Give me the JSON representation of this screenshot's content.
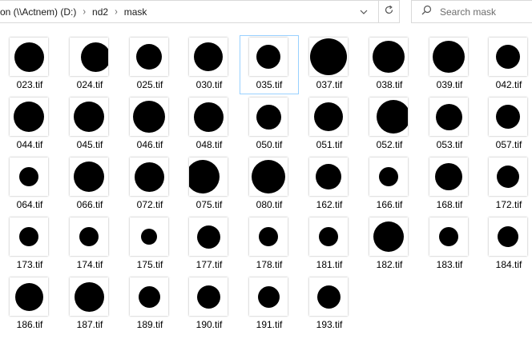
{
  "address_bar": {
    "crumbs": [
      "on (\\\\Actnem) (D:)",
      "nd2",
      "mask"
    ]
  },
  "search": {
    "placeholder": "Search mask"
  },
  "files": [
    {
      "name": "023.tif",
      "dot": 0.78
    },
    {
      "name": "024.tif",
      "dot": 0.78
    },
    {
      "name": "025.tif",
      "dot": 0.66
    },
    {
      "name": "030.tif",
      "dot": 0.76
    },
    {
      "name": "035.tif",
      "dot": 0.62
    },
    {
      "name": "037.tif",
      "dot": 0.96
    },
    {
      "name": "038.tif",
      "dot": 0.84
    },
    {
      "name": "039.tif",
      "dot": 0.84
    },
    {
      "name": "042.tif",
      "dot": 0.62
    },
    {
      "name": "044.tif",
      "dot": 0.8
    },
    {
      "name": "045.tif",
      "dot": 0.8
    },
    {
      "name": "046.tif",
      "dot": 0.84
    },
    {
      "name": "048.tif",
      "dot": 0.78
    },
    {
      "name": "050.tif",
      "dot": 0.64
    },
    {
      "name": "051.tif",
      "dot": 0.74
    },
    {
      "name": "052.tif",
      "dot": 0.88
    },
    {
      "name": "053.tif",
      "dot": 0.68
    },
    {
      "name": "057.tif",
      "dot": 0.62
    },
    {
      "name": "064.tif",
      "dot": 0.5
    },
    {
      "name": "066.tif",
      "dot": 0.8
    },
    {
      "name": "072.tif",
      "dot": 0.78
    },
    {
      "name": "075.tif",
      "dot": 0.88
    },
    {
      "name": "080.tif",
      "dot": 0.88
    },
    {
      "name": "162.tif",
      "dot": 0.66
    },
    {
      "name": "166.tif",
      "dot": 0.5
    },
    {
      "name": "168.tif",
      "dot": 0.7
    },
    {
      "name": "172.tif",
      "dot": 0.58
    },
    {
      "name": "173.tif",
      "dot": 0.5
    },
    {
      "name": "174.tif",
      "dot": 0.5
    },
    {
      "name": "175.tif",
      "dot": 0.42
    },
    {
      "name": "177.tif",
      "dot": 0.6
    },
    {
      "name": "178.tif",
      "dot": 0.5
    },
    {
      "name": "181.tif",
      "dot": 0.5
    },
    {
      "name": "182.tif",
      "dot": 0.8
    },
    {
      "name": "183.tif",
      "dot": 0.5
    },
    {
      "name": "184.tif",
      "dot": 0.54
    },
    {
      "name": "186.tif",
      "dot": 0.72
    },
    {
      "name": "187.tif",
      "dot": 0.78
    },
    {
      "name": "189.tif",
      "dot": 0.56
    },
    {
      "name": "190.tif",
      "dot": 0.6
    },
    {
      "name": "191.tif",
      "dot": 0.56
    },
    {
      "name": "193.tif",
      "dot": 0.6
    }
  ],
  "selected_file": "035.tif",
  "colors": {
    "selection_border": "#99d1ff",
    "mask_fill": "#000000",
    "thumb_bg": "#ffffff"
  }
}
